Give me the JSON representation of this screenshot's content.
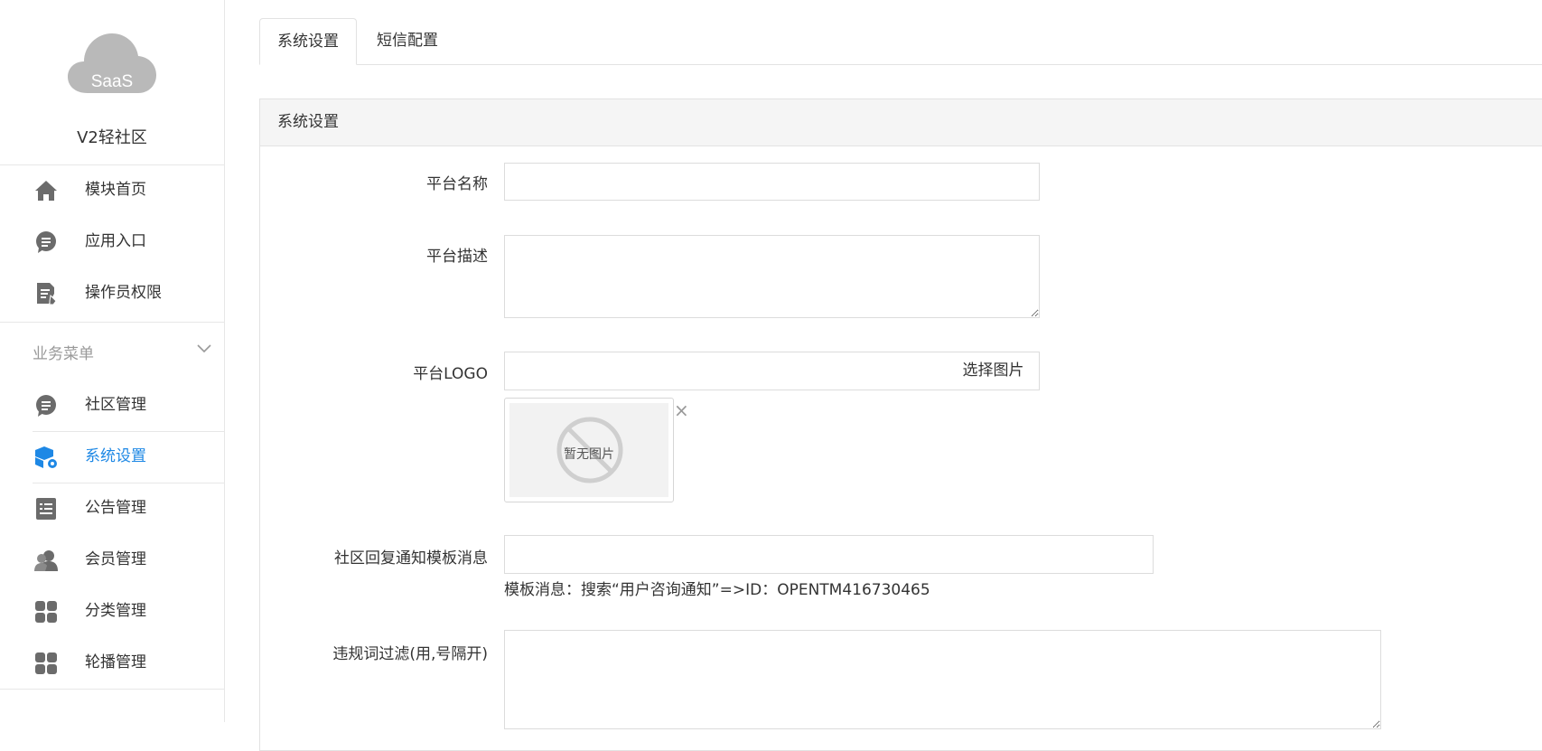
{
  "logo": {
    "text": "SaaS"
  },
  "site_name": "V2轻社区",
  "nav_top": [
    {
      "label": "模块首页",
      "icon": "home-icon"
    },
    {
      "label": "应用入口",
      "icon": "chat-icon"
    },
    {
      "label": "操作员权限",
      "icon": "document-edit-icon"
    }
  ],
  "group": {
    "label": "业务菜单"
  },
  "nav_group": [
    {
      "label": "社区管理",
      "icon": "chat-icon"
    },
    {
      "label": "系统设置",
      "icon": "cube-gear-icon",
      "active": true
    },
    {
      "label": "公告管理",
      "icon": "notice-icon"
    },
    {
      "label": "会员管理",
      "icon": "users-icon"
    },
    {
      "label": "分类管理",
      "icon": "grid-icon"
    },
    {
      "label": "轮播管理",
      "icon": "grid-icon"
    }
  ],
  "tabs": [
    {
      "label": "系统设置",
      "active": true
    },
    {
      "label": "短信配置",
      "active": false
    }
  ],
  "panel": {
    "title": "系统设置",
    "fields": {
      "platform_name": {
        "label": "平台名称",
        "value": ""
      },
      "platform_desc": {
        "label": "平台描述",
        "value": ""
      },
      "platform_logo": {
        "label": "平台LOGO",
        "value": "",
        "button": "选择图片",
        "no_image": "暂无图片"
      },
      "reply_template": {
        "label": "社区回复通知模板消息",
        "value": "",
        "help": "模板消息：搜索“用户咨询通知”=>ID：OPENTM416730465"
      },
      "word_filter": {
        "label": "违规词过滤(用,号隔开)",
        "value": ""
      }
    }
  },
  "colors": {
    "accent": "#1e88e5",
    "icon_gray": "#6b6b6b",
    "logo_gray": "#b9b9b9"
  }
}
